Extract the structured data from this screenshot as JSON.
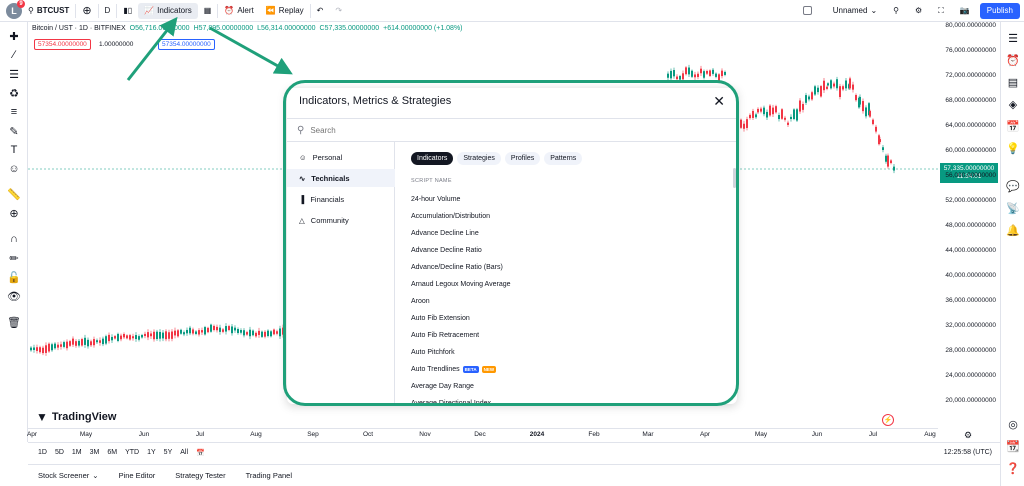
{
  "topbar": {
    "avatar_letter": "L",
    "avatar_badge": "9",
    "ticker": "BTCUST",
    "interval": "D",
    "indicators_label": "Indicators",
    "alert_label": "Alert",
    "replay_label": "Replay",
    "layout_name": "Unnamed",
    "publish_label": "Publish"
  },
  "legend": {
    "symbol": "Bitcoin / UST · 1D · BITFINEX",
    "open": "O56,716.00000000",
    "high": "H57,895.00000000",
    "low": "L56,314.00000000",
    "close": "C57,335.00000000",
    "change": "+614.00000000 (+1.08%)",
    "sell_price": "57354.00000000",
    "qty": "1.00000000",
    "buy_price": "57354.00000000"
  },
  "price_axis": {
    "labels": [
      "80,000.00000000",
      "76,000.00000000",
      "72,000.00000000",
      "68,000.00000000",
      "64,000.00000000",
      "60,000.00000000",
      "56,000.00000000",
      "52,000.00000000",
      "48,000.00000000",
      "44,000.00000000",
      "40,000.00000000",
      "36,000.00000000",
      "32,000.00000000",
      "28,000.00000000",
      "24,000.00000000",
      "20,000.00000000"
    ],
    "last_price": "57,335.00000000",
    "countdown": "11:34:01"
  },
  "time_axis": {
    "labels": [
      "Apr",
      "May",
      "Jun",
      "Jul",
      "Aug",
      "Sep",
      "Oct",
      "Nov",
      "Dec",
      "2024",
      "Feb",
      "Mar",
      "Apr",
      "May",
      "Jun",
      "Jul",
      "Aug"
    ]
  },
  "range_bar": {
    "items": [
      "1D",
      "5D",
      "1M",
      "3M",
      "6M",
      "YTD",
      "1Y",
      "5Y",
      "All"
    ],
    "clock": "12:25:58 (UTC)"
  },
  "bottom_tabs": [
    "Stock Screener",
    "Pine Editor",
    "Strategy Tester",
    "Trading Panel"
  ],
  "logo_text": "TradingView",
  "modal": {
    "title": "Indicators, Metrics & Strategies",
    "search_placeholder": "Search",
    "sidebar": [
      {
        "label": "Personal",
        "icon": "person-icon"
      },
      {
        "label": "Technicals",
        "icon": "chart-line-icon"
      },
      {
        "label": "Financials",
        "icon": "bar-chart-icon"
      },
      {
        "label": "Community",
        "icon": "community-icon"
      }
    ],
    "tabs": [
      "Indicators",
      "Strategies",
      "Profiles",
      "Patterns"
    ],
    "list_header": "SCRIPT NAME",
    "scripts": [
      "24-hour Volume",
      "Accumulation/Distribution",
      "Advance Decline Line",
      "Advance Decline Ratio",
      "Advance/Decline Ratio (Bars)",
      "Arnaud Legoux Moving Average",
      "Aroon",
      "Auto Fib Extension",
      "Auto Fib Retracement",
      "Auto Pitchfork",
      "Auto Trendlines",
      "Average Day Range",
      "Average Directional Index"
    ],
    "tag_beta": "BETA",
    "tag_new": "NEW"
  },
  "colors": {
    "accent": "#2962ff",
    "up": "#089981",
    "down": "#f23645",
    "annotation": "#1fa07a"
  }
}
